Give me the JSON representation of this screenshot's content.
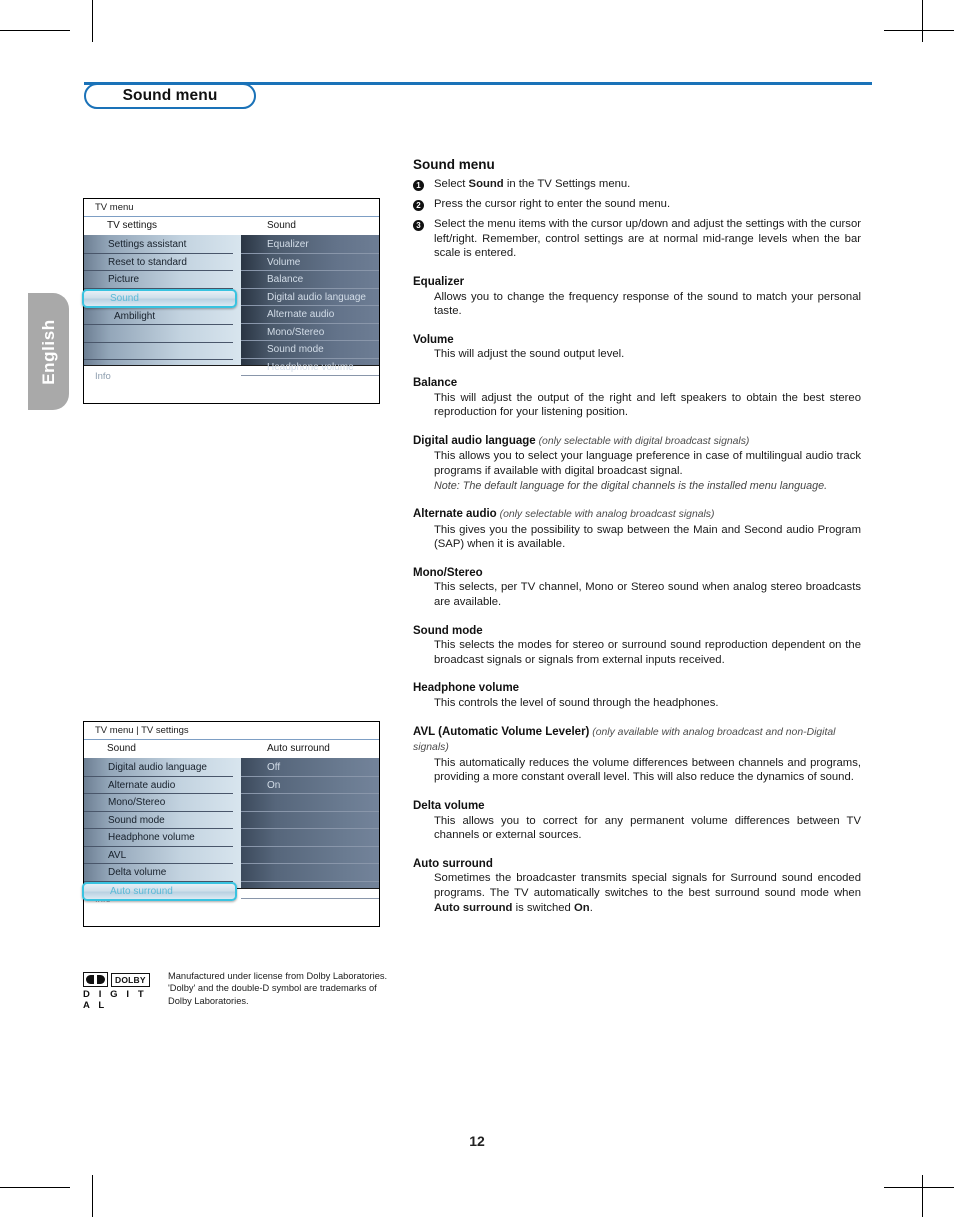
{
  "header": {
    "title": "Sound menu"
  },
  "sidebar": {
    "language_tab": "English"
  },
  "page": {
    "number": "12"
  },
  "tv_menu_1": {
    "breadcrumb": "TV menu",
    "left_column_header": "TV settings",
    "right_column_header": "Sound",
    "info_label": "Info",
    "left_items": [
      {
        "label": "Settings assistant",
        "selected": false,
        "indent": false
      },
      {
        "label": "Reset to standard",
        "selected": false,
        "indent": false
      },
      {
        "label": "Picture",
        "selected": false,
        "indent": false
      },
      {
        "label": "Sound",
        "selected": true,
        "indent": false
      },
      {
        "label": "Ambilight",
        "selected": false,
        "indent": true
      },
      {
        "label": "",
        "selected": false,
        "indent": false
      },
      {
        "label": "",
        "selected": false,
        "indent": false
      }
    ],
    "right_items": [
      {
        "label": "Equalizer"
      },
      {
        "label": "Volume"
      },
      {
        "label": "Balance"
      },
      {
        "label": "Digital audio language"
      },
      {
        "label": "Alternate audio"
      },
      {
        "label": "Mono/Stereo"
      },
      {
        "label": "Sound mode"
      },
      {
        "label": "Headphone volume"
      }
    ]
  },
  "tv_menu_2": {
    "breadcrumb": "TV menu | TV settings",
    "left_column_header": "Sound",
    "right_column_header": "Auto surround",
    "info_label": "Info",
    "left_items": [
      {
        "label": "Digital audio language",
        "selected": false,
        "indent": false
      },
      {
        "label": "Alternate audio",
        "selected": false,
        "indent": false
      },
      {
        "label": "Mono/Stereo",
        "selected": false,
        "indent": false
      },
      {
        "label": "Sound mode",
        "selected": false,
        "indent": false
      },
      {
        "label": "Headphone volume",
        "selected": false,
        "indent": false
      },
      {
        "label": "AVL",
        "selected": false,
        "indent": false
      },
      {
        "label": "Delta volume",
        "selected": false,
        "indent": false
      },
      {
        "label": "Auto surround",
        "selected": true,
        "indent": false
      }
    ],
    "right_items": [
      {
        "label": "Off"
      },
      {
        "label": "On"
      },
      {
        "label": ""
      },
      {
        "label": ""
      },
      {
        "label": ""
      },
      {
        "label": ""
      },
      {
        "label": ""
      },
      {
        "label": ""
      }
    ]
  },
  "dolby": {
    "symbol_label": "DOLBY",
    "wordmark": "D I G I T A L",
    "notice_line1": "Manufactured under license from Dolby Laboratories.",
    "notice_line2": "'Dolby' and the double-D symbol are trademarks of",
    "notice_line3": "Dolby Laboratories."
  },
  "content": {
    "section_title": "Sound menu",
    "steps": [
      {
        "num": "1",
        "text_pre": "Select ",
        "bold": "Sound",
        "text_post": " in the TV Settings menu."
      },
      {
        "num": "2",
        "text_pre": "Press the cursor right to enter the sound menu.",
        "bold": "",
        "text_post": ""
      },
      {
        "num": "3",
        "text_pre": "Select the menu items with the cursor up/down and adjust the settings with the cursor left/right. Remember, control settings are at normal mid-range levels when the bar scale is entered.",
        "bold": "",
        "text_post": ""
      }
    ],
    "entries": [
      {
        "heading": "Equalizer",
        "qualifier": "",
        "body": "Allows you to change the frequency response of the sound to match your personal taste.",
        "note": ""
      },
      {
        "heading": "Volume",
        "qualifier": "",
        "body": "This will adjust the sound output level.",
        "note": ""
      },
      {
        "heading": "Balance",
        "qualifier": "",
        "body": "This will adjust the output of the right and left speakers to obtain the best stereo reproduction for your listening position.",
        "note": ""
      },
      {
        "heading": "Digital audio language",
        "qualifier": "(only selectable with digital broadcast signals)",
        "body": "This allows you to select your language preference in case of multilingual audio track programs if available with digital broadcast signal.",
        "note": "Note: The default language for the digital channels is the installed menu language."
      },
      {
        "heading": "Alternate audio",
        "qualifier": "(only selectable with analog broadcast signals)",
        "body": "This gives you the possibility to swap between the Main and Second audio Program (SAP) when it is available.",
        "note": ""
      },
      {
        "heading": "Mono/Stereo",
        "qualifier": "",
        "body": "This selects, per TV channel, Mono or Stereo sound when analog stereo broadcasts are available.",
        "note": ""
      },
      {
        "heading": "Sound mode",
        "qualifier": "",
        "body": "This selects the modes for stereo or surround sound reproduction dependent on the broadcast signals or signals from external inputs received.",
        "note": ""
      },
      {
        "heading": "Headphone volume",
        "qualifier": "",
        "body": "This controls the level of sound through the headphones.",
        "note": ""
      },
      {
        "heading": "AVL (Automatic Volume Leveler)",
        "qualifier": "(only available with analog broadcast and non-Digital signals)",
        "body": "This automatically reduces the volume differences between channels and programs, providing a more constant overall level. This will also reduce the dynamics of sound.",
        "note": ""
      },
      {
        "heading": "Delta volume",
        "qualifier": "",
        "body": "This allows you to correct for any permanent volume differences between TV channels or external sources.",
        "note": ""
      },
      {
        "heading": "Auto surround",
        "qualifier": "",
        "body": "Sometimes the broadcaster transmits special signals for Surround sound encoded programs. The TV automatically switches to the best surround sound mode when Auto surround is switched On.",
        "note": "",
        "body_bold_terms": [
          "Auto surround",
          "On"
        ]
      }
    ]
  },
  "colors": {
    "accent_blue": "#1a72b8",
    "tab_gray": "#a9a9a9",
    "menu_highlight_cyan": "#39c3e0"
  }
}
